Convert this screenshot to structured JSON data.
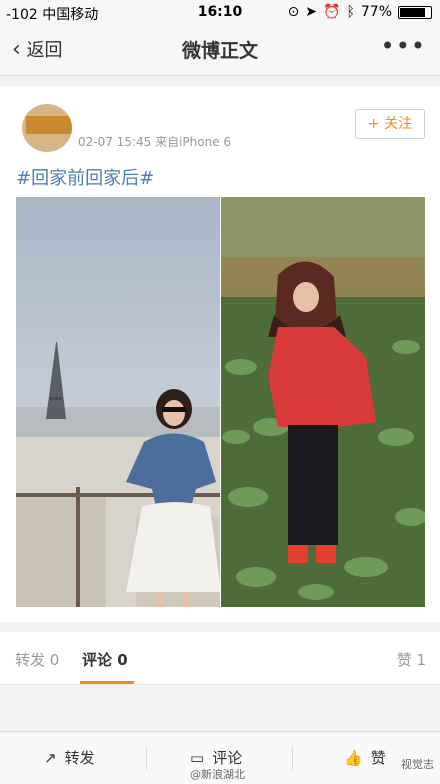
{
  "status": {
    "carrier": "-102 中国移动",
    "time": "16:10",
    "battery_text": "77%",
    "battery_level": 0.77
  },
  "nav": {
    "back_label": "返回",
    "title": "微博正文",
    "more_label": "•••"
  },
  "post": {
    "meta": "02-07 15:45  来自iPhone 6",
    "follow_label": "+ 关注",
    "hashtag": "#回家前回家后#"
  },
  "tabs": {
    "repost": "转发 0",
    "comment": "评论 0",
    "like": "赞 1"
  },
  "bottom": {
    "repost": "转发",
    "comment": "评论",
    "like": "赞"
  },
  "watermark": {
    "right": "视觉志",
    "bottom": "@新浪湖北"
  },
  "colors": {
    "accent": "#f08c1e",
    "link": "#4f7bbd"
  }
}
